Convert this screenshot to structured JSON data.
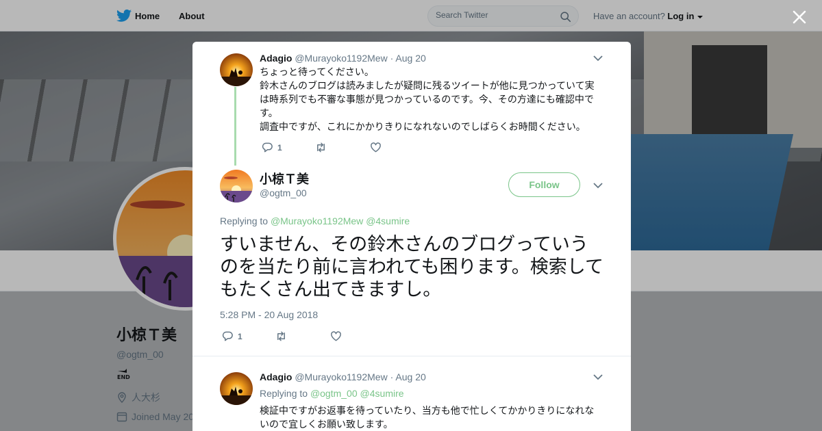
{
  "topbar": {
    "home_label": "Home",
    "about_label": "About",
    "search_placeholder": "Search Twitter",
    "account_prompt": "Have an account?",
    "login_label": "Log in"
  },
  "profile": {
    "name": "小椋Ｔ美",
    "handle": "@ogtm_00",
    "location": "人大杉",
    "joined": "Joined May 20"
  },
  "tweets": [
    {
      "name": "Adagio",
      "handle": "@Murayoko1192Mew",
      "separator": "·",
      "date": "Aug 20",
      "lines": [
        "ちょっと待ってください。",
        "鈴木さんのブログは読みましたが疑問に残るツイートが他に見つかっていて実は時系列でも不審な事態が見つかっているのです。今、その方達にも確認中です。",
        "調査中ですが、これにかかりきりになれないのでしばらくお時間ください。"
      ],
      "reply_count": "1"
    },
    {
      "name": "小椋Ｔ美",
      "handle": "@ogtm_00",
      "follow_label": "Follow",
      "replying_label": "Replying to",
      "mentions": [
        "@Murayoko1192Mew",
        "@4sumire"
      ],
      "text": "すいません、その鈴木さんのブログっていうのを当たり前に言われても困ります。検索してもたくさん出てきますし。",
      "timestamp": "5:28 PM - 20 Aug 2018",
      "reply_count": "1"
    },
    {
      "name": "Adagio",
      "handle": "@Murayoko1192Mew",
      "separator": "·",
      "date": "Aug 20",
      "replying_label": "Replying to",
      "mentions": [
        "@ogtm_00",
        "@4sumire"
      ],
      "text": "検証中ですがお返事を待っていたり、当方も他で忙しくてかかりきりになれないので宜しくお願い致します。"
    }
  ],
  "colors": {
    "accent": "#79c488",
    "brand": "#1da1f2",
    "text": "#14171a",
    "muted": "#657786",
    "thread_line": "#a8dbae"
  }
}
